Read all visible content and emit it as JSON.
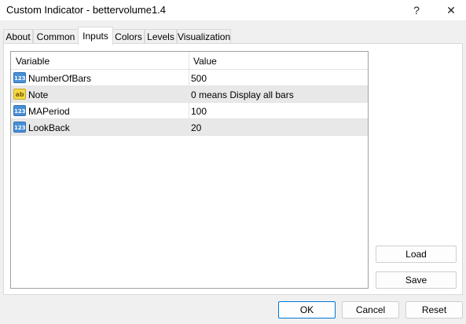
{
  "window": {
    "title": "Custom Indicator - bettervolume1.4",
    "help_label": "?",
    "close_label": "✕"
  },
  "tabs": [
    {
      "label": "About",
      "active": false
    },
    {
      "label": "Common",
      "active": false
    },
    {
      "label": "Inputs",
      "active": true
    },
    {
      "label": "Colors",
      "active": false
    },
    {
      "label": "Levels",
      "active": false
    },
    {
      "label": "Visualization",
      "active": false
    }
  ],
  "grid": {
    "columns": [
      "Variable",
      "Value"
    ],
    "rows": [
      {
        "icon": "number-icon",
        "icon_text": "123",
        "variable": "NumberOfBars",
        "value": "500"
      },
      {
        "icon": "string-icon",
        "icon_text": "ab",
        "variable": "Note",
        "value": "0 means Display all bars"
      },
      {
        "icon": "number-icon",
        "icon_text": "123",
        "variable": "MAPeriod",
        "value": "100"
      },
      {
        "icon": "number-icon",
        "icon_text": "123",
        "variable": "LookBack",
        "value": "20"
      }
    ]
  },
  "buttons": {
    "load": "Load",
    "save": "Save",
    "ok": "OK",
    "cancel": "Cancel",
    "reset": "Reset"
  }
}
